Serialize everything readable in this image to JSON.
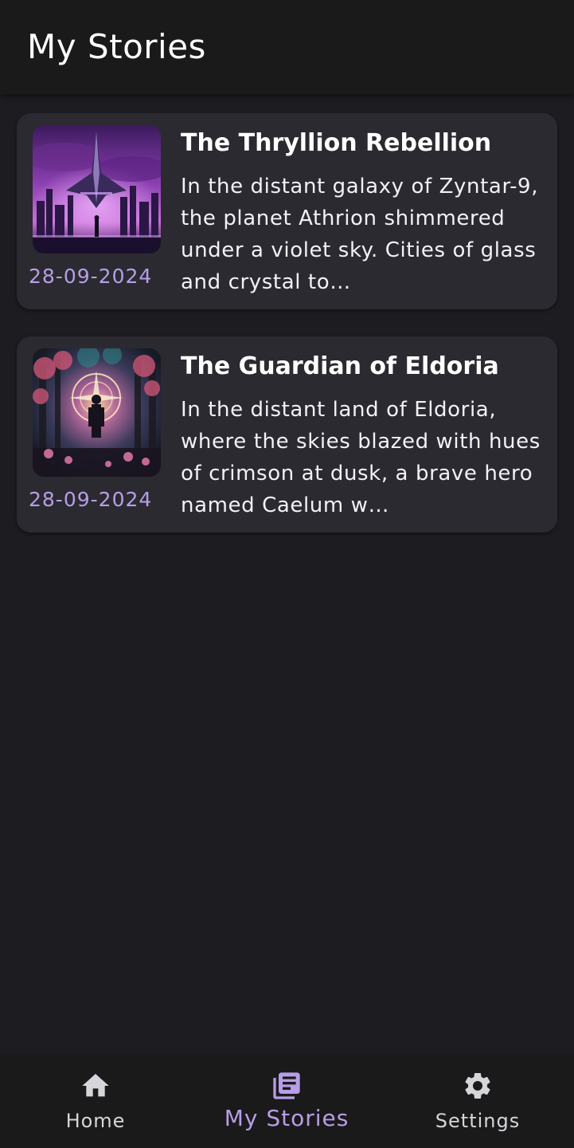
{
  "header": {
    "title": "My Stories"
  },
  "stories": [
    {
      "title": "The Thryllion Rebellion",
      "excerpt": "In the distant galaxy of Zyntar-9, the planet Athrion shimmered under a violet sky. Cities of glass and crystal to…",
      "date": "28-09-2024"
    },
    {
      "title": "The Guardian of Eldoria",
      "excerpt": "In the distant land of Eldoria, where the skies blazed with hues of crimson at dusk, a brave hero named Caelum w…",
      "date": "28-09-2024"
    }
  ],
  "bottom_nav": {
    "items": [
      {
        "label": "Home",
        "icon": "home-icon",
        "active": false
      },
      {
        "label": "My Stories",
        "icon": "stories-icon",
        "active": true
      },
      {
        "label": "Settings",
        "icon": "gear-icon",
        "active": false
      }
    ]
  },
  "colors": {
    "background": "#1d1c21",
    "bar": "#1a1a1b",
    "card": "#2b2a31",
    "accent": "#b79ee6",
    "text": "#ffffff",
    "inactive": "#d6d5da"
  }
}
